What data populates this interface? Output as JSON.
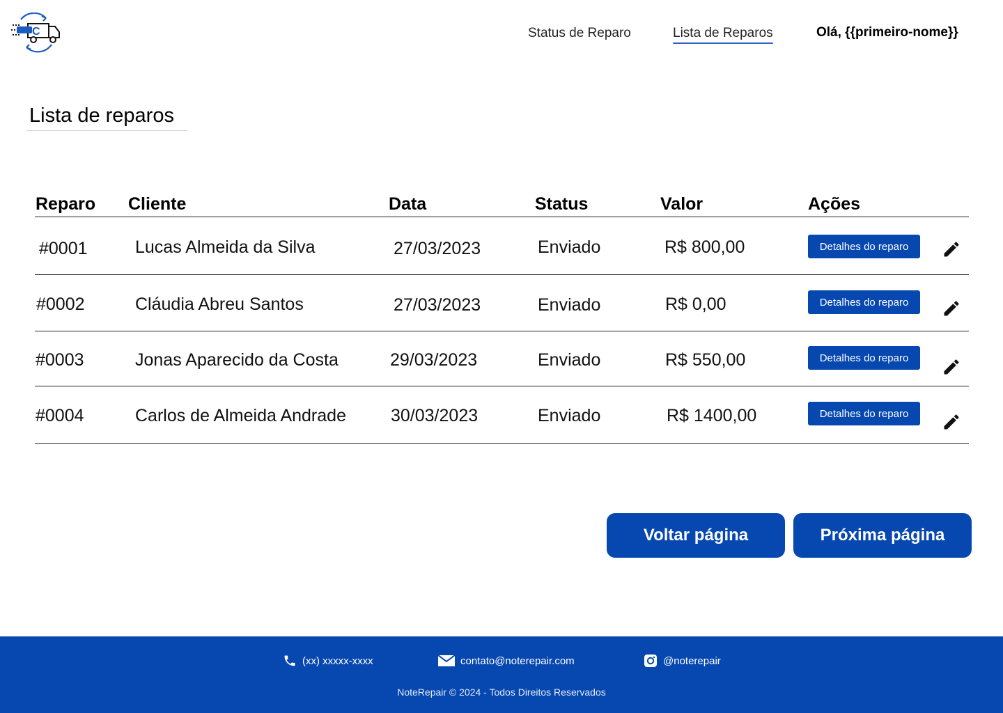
{
  "header": {
    "nav": {
      "status": "Status de Reparo",
      "lista": "Lista de Reparos"
    },
    "greeting": "Olá, {{primeiro-nome}}"
  },
  "main": {
    "title": "Lista de reparos",
    "columns": {
      "reparo": "Reparo",
      "cliente": "Cliente",
      "data": "Data",
      "status": "Status",
      "valor": "Valor",
      "acoes": "Ações"
    },
    "rows": [
      {
        "id": "#0001",
        "cliente": "Lucas Almeida da Silva",
        "data": "27/03/2023",
        "status": "Enviado",
        "valor": "R$ 800,00",
        "action_label": "Detalhes do reparo"
      },
      {
        "id": "#0002",
        "cliente": "Cláudia Abreu Santos",
        "data": "27/03/2023",
        "status": "Enviado",
        "valor": "R$ 0,00",
        "action_label": "Detalhes do reparo"
      },
      {
        "id": "#0003",
        "cliente": "Jonas Aparecido da Costa",
        "data": "29/03/2023",
        "status": "Enviado",
        "valor": "R$ 550,00",
        "action_label": "Detalhes do reparo"
      },
      {
        "id": "#0004",
        "cliente": "Carlos de Almeida Andrade",
        "data": "30/03/2023",
        "status": "Enviado",
        "valor": "R$ 1400,00",
        "action_label": "Detalhes do reparo"
      }
    ],
    "pagination": {
      "prev": "Voltar página",
      "next": "Próxima página"
    }
  },
  "footer": {
    "phone": "(xx) xxxxx-xxxx",
    "email": "contato@noterepair.com",
    "instagram": "@noterepair",
    "copyright": "NoteRepair © 2024 - Todos Direitos Reservados"
  },
  "icons": {
    "logo": "truck-repair-logo",
    "edit": "pencil-icon",
    "phone": "phone-icon",
    "email": "envelope-icon",
    "instagram": "instagram-icon"
  },
  "colors": {
    "brand": "#0647b0",
    "nav_underline": "#2f62c9",
    "text": "#111111",
    "background": "#ffffff"
  }
}
